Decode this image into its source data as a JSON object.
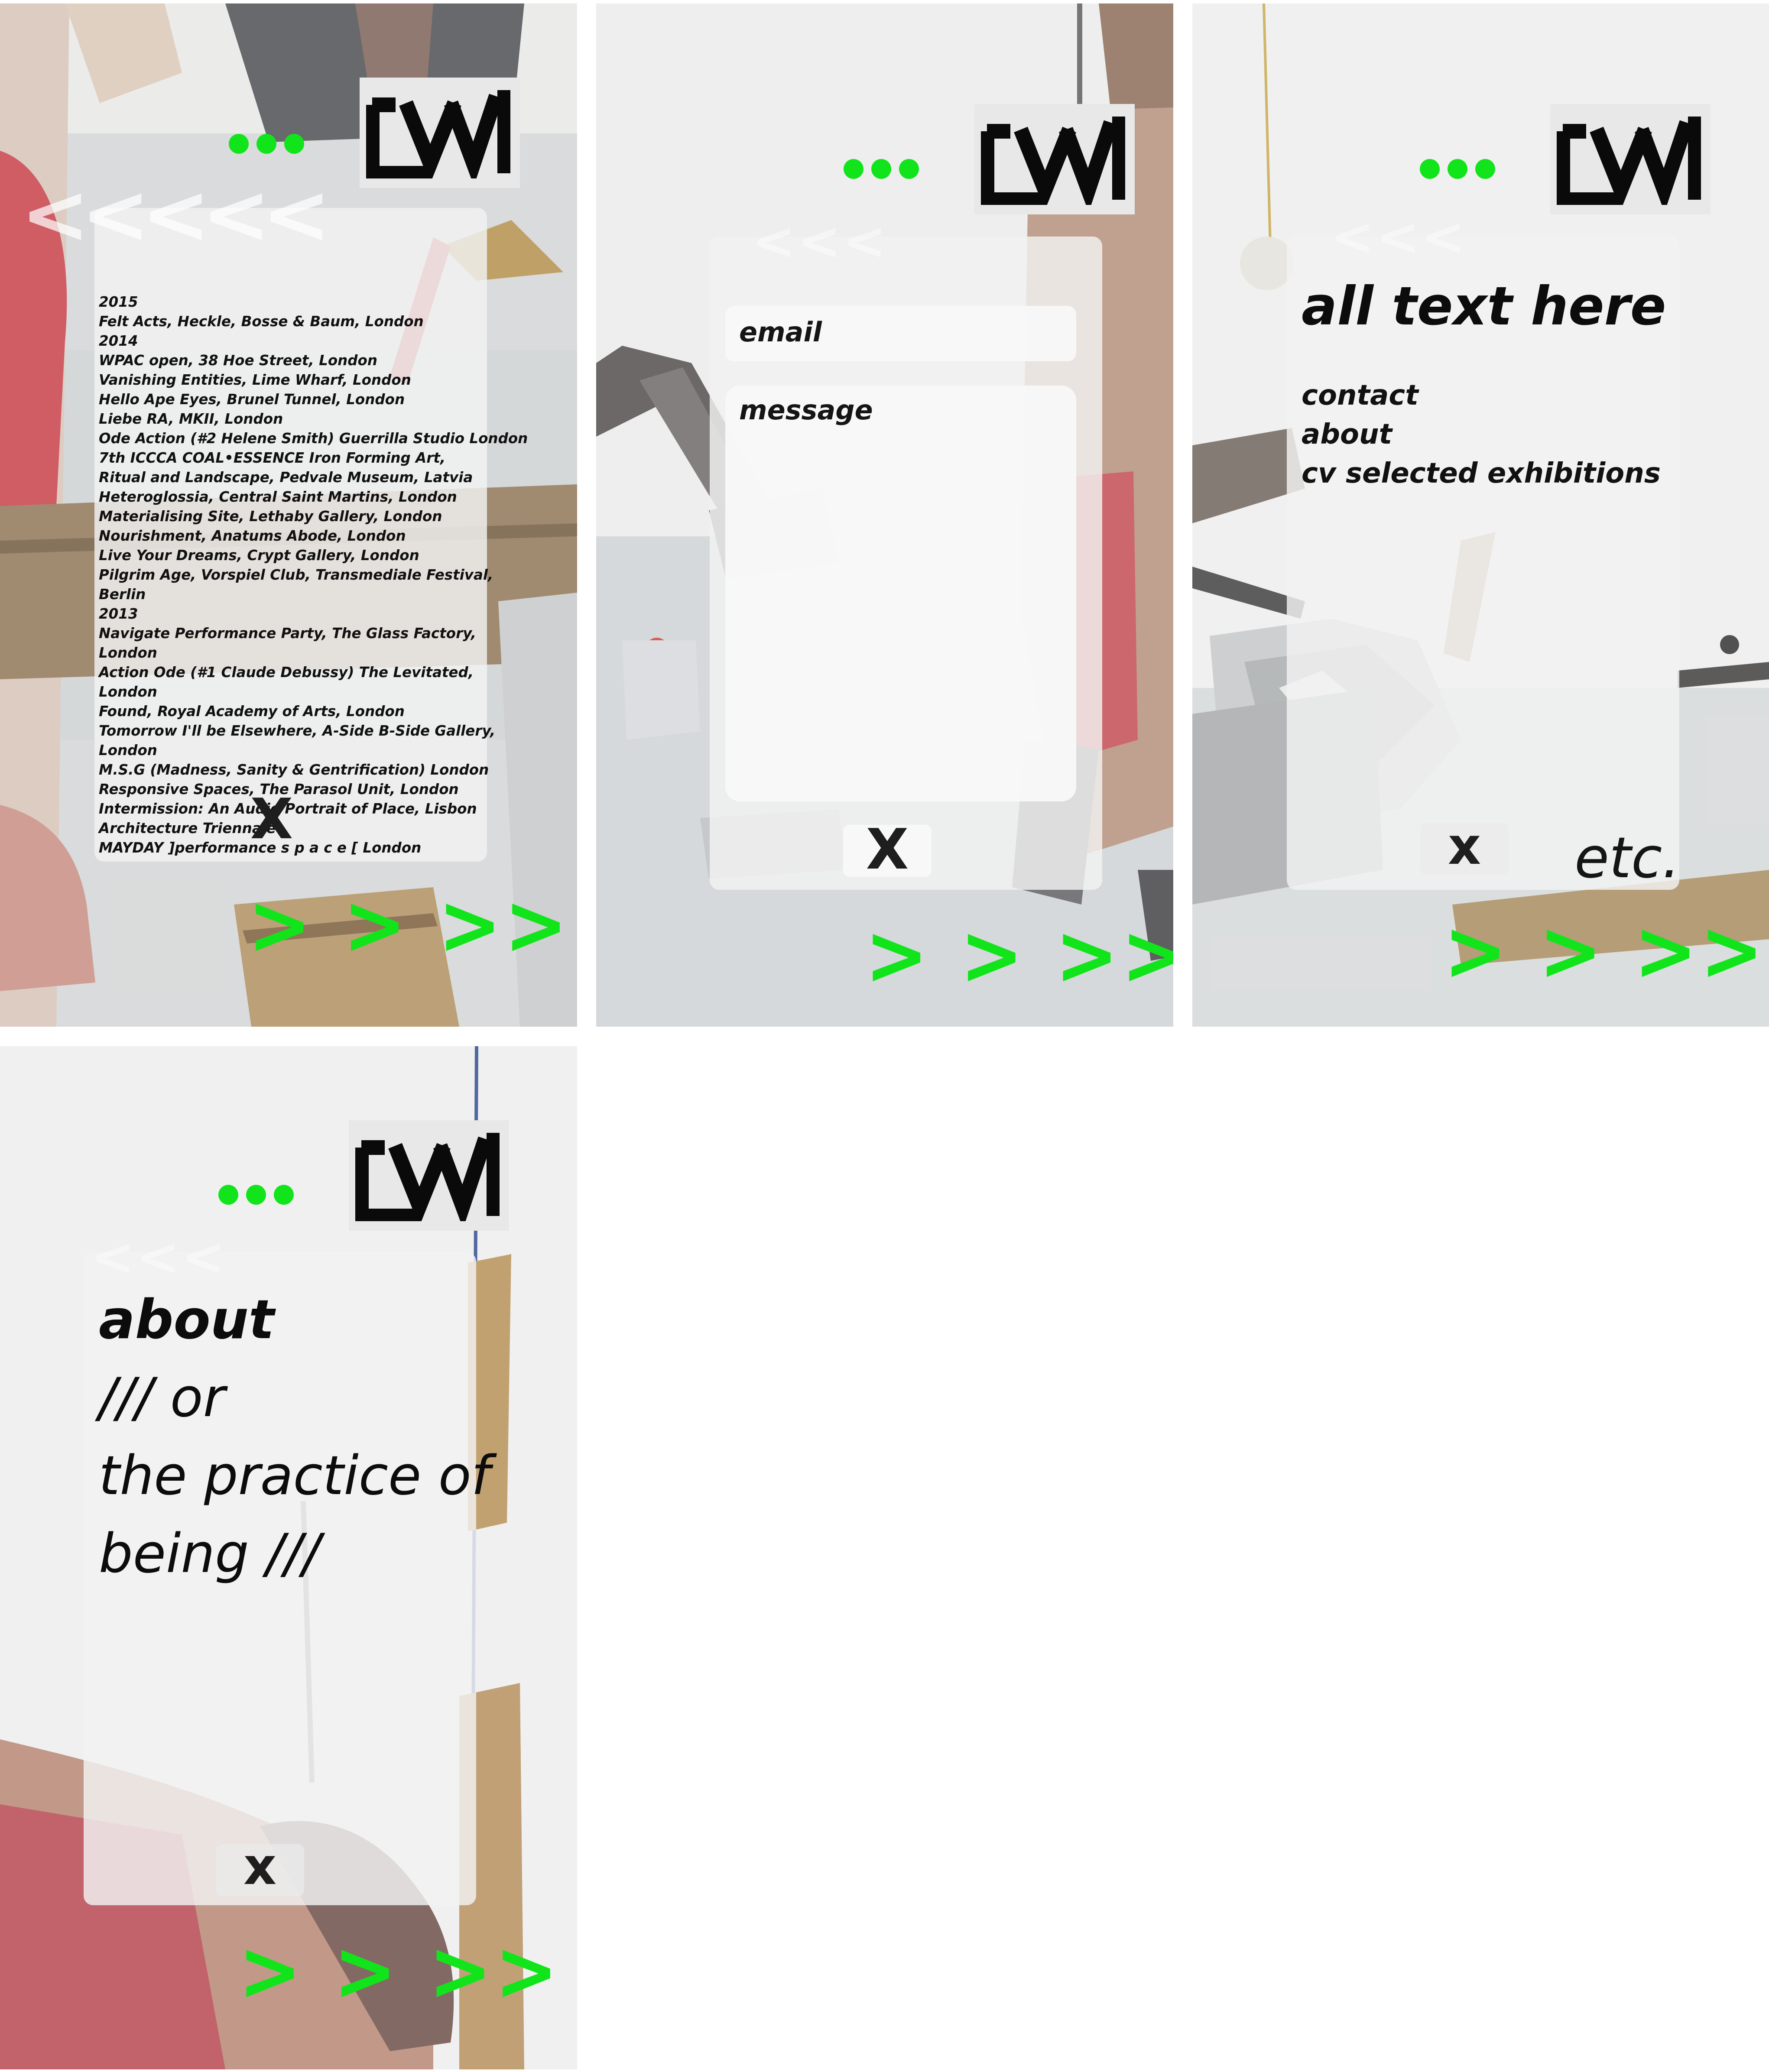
{
  "brand": {
    "logo_text": "LVVL",
    "accent_color": "#12e41b",
    "menu_dots_icon": "three-dots-icon"
  },
  "screens": {
    "cv": {
      "back_chevrons": "<<<<<",
      "entries": [
        "2015",
        "Felt Acts, Heckle, Bosse & Baum, London",
        "2014",
        "WPAC open, 38 Hoe Street, London",
        "Vanishing Entities, Lime Wharf, London",
        "Hello Ape Eyes, Brunel Tunnel, London",
        "Liebe RA, MKII, London",
        "Ode Action (#2 Helene Smith) Guerrilla Studio London",
        "7th ICCCA COAL•ESSENCE Iron Forming Art,",
        "Ritual and Landscape, Pedvale Museum, Latvia",
        "Heteroglossia, Central Saint Martins, London",
        "Materialising Site, Lethaby Gallery, London",
        "Nourishment, Anatums Abode, London",
        "Live Your Dreams, Crypt Gallery, London",
        "Pilgrim Age, Vorspiel Club, Transmediale Festival,",
        " Berlin",
        "2013",
        "Navigate Performance Party, The Glass Factory,",
        " London",
        "Action Ode (#1 Claude Debussy) The Levitated,",
        "London",
        "Found, Royal Academy of Arts, London",
        "Tomorrow I'll be Elsewhere, A-Side B-Side Gallery,",
        " London",
        "M.S.G (Madness, Sanity & Gentrification) London",
        "Responsive Spaces, The Parasol Unit, London",
        "Intermission: An Audio Portrait of Place, Lisbon",
        "Architecture Triennale",
        "MAYDAY ]performance s p a c e [ London"
      ],
      "close_label": "X",
      "next_label": "> > >>"
    },
    "contact": {
      "email_placeholder": "email",
      "message_placeholder": "message",
      "close_label": "X",
      "next_label": "> > >>"
    },
    "menu": {
      "heading": "all text here",
      "items": [
        "contact",
        "about",
        "cv selected exhibitions"
      ],
      "close_label": "x",
      "etc_label": "etc.",
      "next_label": "> > >>"
    },
    "about": {
      "title": "about",
      "lines": [
        "/// or",
        "the practice of",
        "being ///"
      ],
      "close_label": "x",
      "next_label": "> > >>"
    }
  }
}
